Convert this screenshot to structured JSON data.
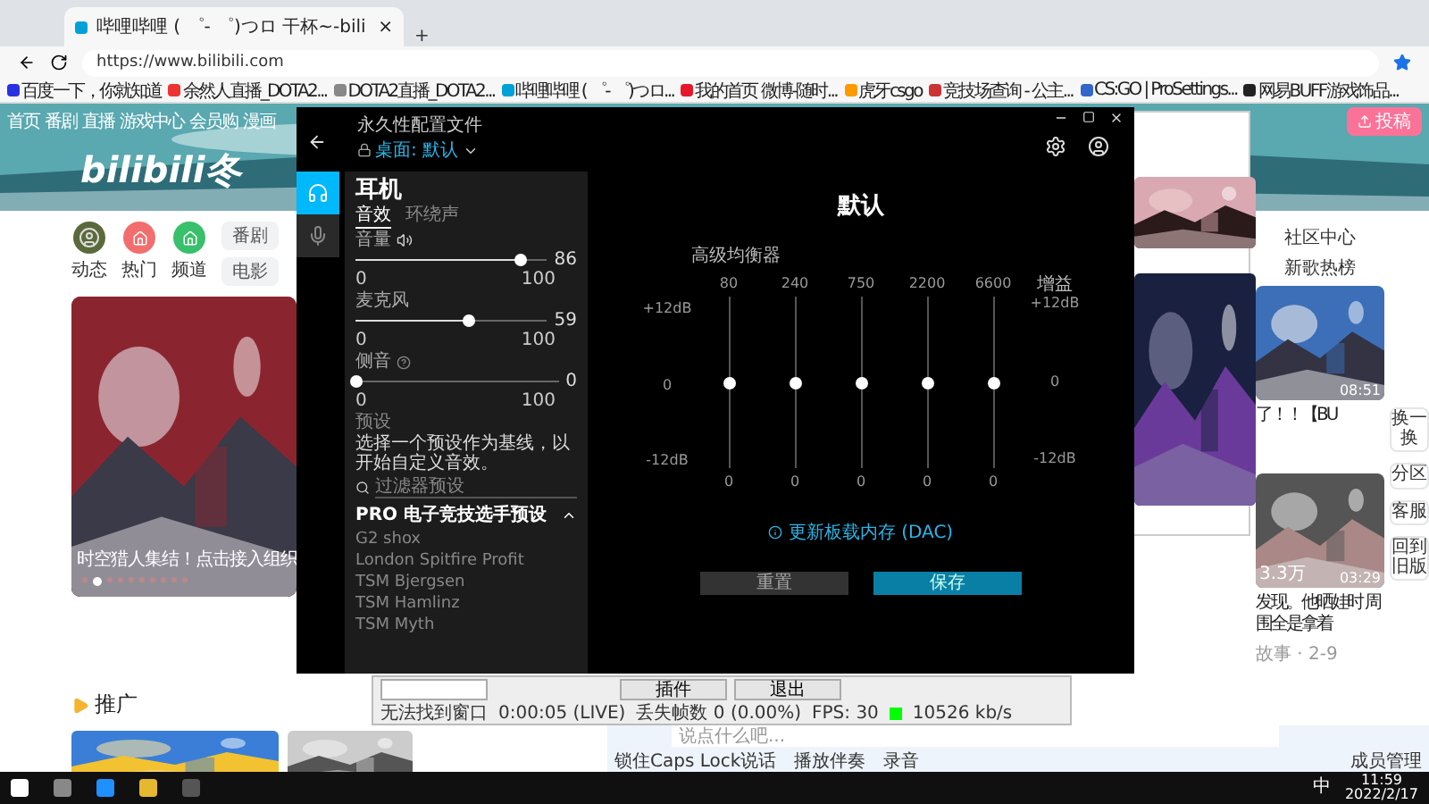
{
  "browser": {
    "tab": {
      "title": "哔哩哔哩 ( ゜- ゜)つロ 干杯~-bili",
      "close": "×"
    },
    "new_tab": "+",
    "url": "https://www.bilibili.com",
    "bookmarks": [
      "百度一下，你就知道",
      "余然人直播_DOTA2...",
      "DOTA2直播_DOTA2...",
      "哔哩哔哩 ( ゜- ゜)つロ...",
      "我的首页 微博-随时...",
      "虎牙csgo",
      "竞技场查询 - 公主...",
      "CS:GO | ProSettings...",
      "网易BUFF游戏饰品..."
    ]
  },
  "site": {
    "nav": [
      "首页",
      "番剧",
      "直播",
      "游戏中心",
      "会员购",
      "漫画"
    ],
    "upload": "投稿",
    "logo": "bilibili冬",
    "shortcuts": [
      {
        "label": "动态",
        "kind": "avatar",
        "color": "#5a6a3a"
      },
      {
        "label": "热门",
        "kind": "icon",
        "color": "#f26d6d"
      },
      {
        "label": "频道",
        "kind": "icon",
        "color": "#39c06a"
      }
    ],
    "pills": [
      "番剧",
      "电影"
    ],
    "carousel": {
      "caption": "时空猎人集结！点击接入组织",
      "dots": [
        {
          "selected": false
        },
        {
          "selected": true
        },
        {
          "selected": false
        },
        {
          "selected": false
        },
        {
          "selected": false
        },
        {
          "selected": false
        },
        {
          "selected": false
        },
        {
          "selected": false
        },
        {
          "selected": false
        },
        {
          "selected": false
        }
      ]
    },
    "promo_heading": "推广",
    "links": [
      "社区中心",
      "新歌热榜"
    ],
    "videos": [
      {
        "duration": "08:51",
        "title": "了！！【BU"
      },
      {
        "duration": "03:29",
        "likes": "3.3万",
        "title": "发现。他晒娃时 周围全是拿着",
        "meta": "故事 · 2-9"
      }
    ],
    "side_buttons": [
      "换一换",
      "分区",
      "客服",
      "回到旧版"
    ]
  },
  "ghub": {
    "profile_label": "永久性配置文件",
    "profile": "桌面: 默认",
    "devices": [
      {
        "kind": "headphones",
        "selected": true
      },
      {
        "kind": "microphone",
        "selected": false
      }
    ],
    "title": "耳机",
    "tabs": [
      {
        "label": "音效",
        "selected": true
      },
      {
        "label": "环绕声",
        "selected": false
      }
    ],
    "sliders": [
      {
        "label": "音量",
        "level": 0.86,
        "reading": "86",
        "min": "0",
        "max": "100"
      },
      {
        "label": "麦克风",
        "level": 0.59,
        "reading": "59",
        "min": "0",
        "max": "100"
      },
      {
        "label": "侧音",
        "level": 0,
        "reading": "0",
        "min": "0",
        "max": "100"
      }
    ],
    "presets_heading": "预设",
    "presets_hint": "选择一个预设作为基线，以开始自定义音效。",
    "search": {
      "placeholder": "过滤器预设"
    },
    "group": {
      "title": "PRO 电子竞技选手预设",
      "expanded": true,
      "items": [
        "G2 shox",
        "London Spitfire Profit",
        "TSM Bjergsen",
        "TSM Hamlinz",
        "TSM Myth"
      ]
    },
    "eq": {
      "title": "默认",
      "label": "高级均衡器",
      "gain_label": "增益",
      "scale": {
        "top": "+12dB",
        "mid": "0",
        "bottom": "-12dB"
      },
      "gain_scale": {
        "top": "+12dB",
        "mid": "0",
        "bottom": "-12dB"
      },
      "bands": [
        {
          "freq": "80",
          "level": 0.5,
          "reading": "0"
        },
        {
          "freq": "240",
          "level": 0.5,
          "reading": "0"
        },
        {
          "freq": "750",
          "level": 0.5,
          "reading": "0"
        },
        {
          "freq": "2200",
          "level": 0.5,
          "reading": "0"
        },
        {
          "freq": "6600",
          "level": 0.5,
          "reading": "0"
        }
      ],
      "dac": "更新板载内存 (DAC)",
      "buttons": [
        {
          "label": "重置",
          "kind": "secondary"
        },
        {
          "label": "保存",
          "kind": "primary"
        }
      ]
    }
  },
  "obs": {
    "buttons": [
      "插件",
      "退出"
    ],
    "status": [
      "无法找到窗口",
      "0:00:05 (LIVE)",
      "丢失帧数 0 (0.00%)",
      "FPS: 30"
    ],
    "bitrate": "10526 kb/s"
  },
  "chat": {
    "placeholder": "说点什么吧...",
    "tools": [
      "锁住Caps Lock说话",
      "播放伴奏",
      "录音"
    ],
    "member": "成员管理"
  },
  "taskbar": {
    "ime": "中",
    "time": "11:59",
    "date": "2022/2/17"
  }
}
